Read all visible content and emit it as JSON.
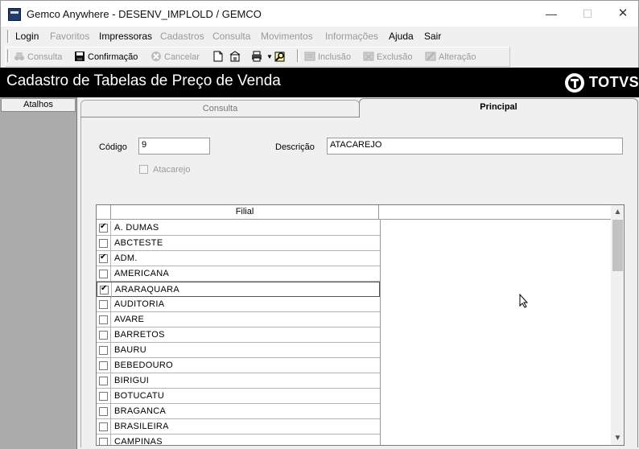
{
  "window": {
    "title": "Gemco Anywhere - DESENV_IMPLOLD / GEMCO"
  },
  "menu": [
    {
      "label": "Login",
      "enabled": true
    },
    {
      "label": "Favoritos",
      "enabled": false
    },
    {
      "label": "Impressoras",
      "enabled": true
    },
    {
      "label": "Cadastros",
      "enabled": false
    },
    {
      "label": "Consulta",
      "enabled": false
    },
    {
      "label": "Movimentos",
      "enabled": false
    },
    {
      "label": "Informações",
      "enabled": false
    },
    {
      "label": "Ajuda",
      "enabled": true
    },
    {
      "label": "Sair",
      "enabled": true
    }
  ],
  "toolbar": {
    "consulta": "Consulta",
    "confirmacao": "Confirmação",
    "cancelar": "Cancelar",
    "inclusao": "Inclusão",
    "exclusao": "Exclusão",
    "alteracao": "Alteração"
  },
  "header": {
    "title": "Cadastro de Tabelas de Preço de Venda",
    "logo": "TOTVS"
  },
  "sidebar": {
    "title": "Atalhos"
  },
  "tabs": {
    "consulta": "Consulta",
    "principal": "Principal"
  },
  "form": {
    "codigo_label": "Código",
    "codigo_value": "9",
    "descricao_label": "Descrição",
    "descricao_value": "ATACAREJO",
    "atacarejo_label": "Atacarejo"
  },
  "grid": {
    "column": "Filial",
    "rows": [
      {
        "name": "A. DUMAS",
        "checked": true
      },
      {
        "name": "ABCTESTE",
        "checked": false
      },
      {
        "name": "ADM.",
        "checked": true
      },
      {
        "name": "AMERICANA",
        "checked": false
      },
      {
        "name": "ARARAQUARA",
        "checked": true
      },
      {
        "name": "AUDITORIA",
        "checked": false
      },
      {
        "name": "AVARE",
        "checked": false
      },
      {
        "name": "BARRETOS",
        "checked": false
      },
      {
        "name": "BAURU",
        "checked": false
      },
      {
        "name": "BEBEDOURO",
        "checked": false
      },
      {
        "name": "BIRIGUI",
        "checked": false
      },
      {
        "name": "BOTUCATU",
        "checked": false
      },
      {
        "name": "BRAGANCA",
        "checked": false
      },
      {
        "name": "BRASILEIRA",
        "checked": false
      },
      {
        "name": "CAMPINAS",
        "checked": false
      }
    ]
  }
}
